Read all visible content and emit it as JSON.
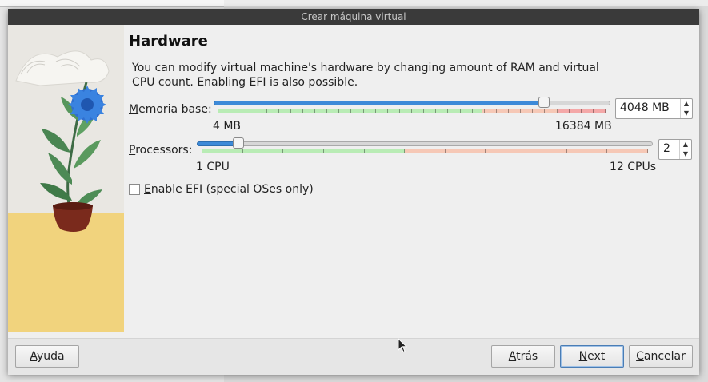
{
  "window": {
    "title": "Crear máquina virtual"
  },
  "page": {
    "heading": "Hardware",
    "description": "You can modify virtual machine's hardware by changing amount of RAM and virtual CPU count. Enabling EFI is also possible."
  },
  "memory": {
    "label_accel": "M",
    "label_rest": "emoria base:",
    "min_label": "4 MB",
    "max_label": "16384 MB",
    "value": "4048 MB",
    "min": 4,
    "max": 16384,
    "current": 4048
  },
  "processors": {
    "label_accel": "P",
    "label_rest": "rocessors:",
    "min_label": "1 CPU",
    "max_label": "12 CPUs",
    "value": "2",
    "min": 1,
    "max": 12,
    "current": 2
  },
  "efi": {
    "label_accel": "E",
    "label_rest": "nable EFI (special OSes only)",
    "checked": false
  },
  "buttons": {
    "help_accel": "A",
    "help_rest": "yuda",
    "back_accel": "A",
    "back_rest": "trás",
    "next_accel": "N",
    "next_rest": "ext",
    "cancel_accel": "C",
    "cancel_rest": "ancelar"
  },
  "colors": {
    "accent": "#3d8ad8",
    "scale_green": "#b9ecb5",
    "scale_salmon": "#f6c8b6",
    "scale_red": "#f4a8a8",
    "titlebar": "#3a3a3a"
  }
}
